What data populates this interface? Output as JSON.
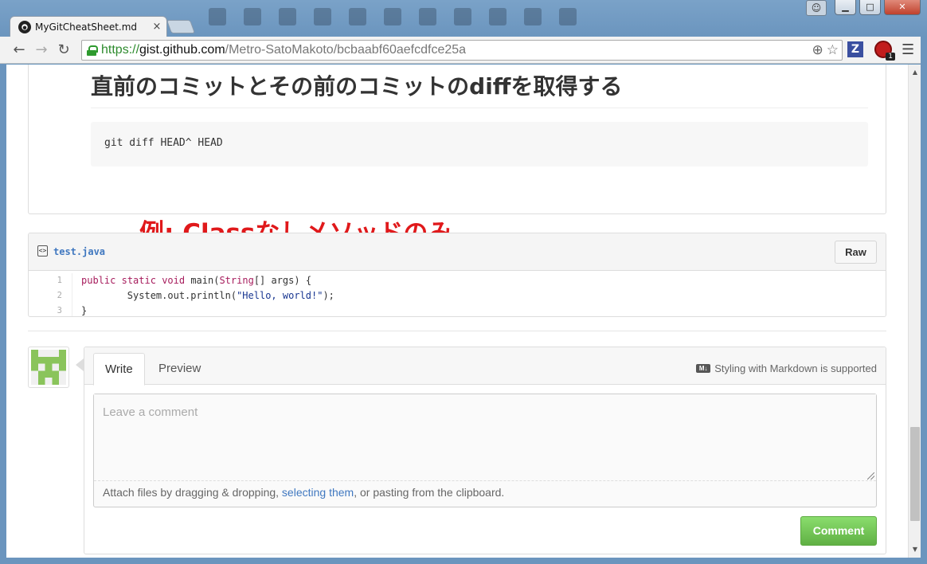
{
  "browser": {
    "tab_title": "MyGitCheatSheet.md",
    "tab_close": "×",
    "url_scheme": "https://",
    "url_host": "gist.github.com",
    "url_path": "/Metro-SatoMakoto/bcbaabf60aefcdfce25a",
    "ext_badge_count": "1",
    "ext_z_label": "Z"
  },
  "markdown": {
    "heading": "直前のコミットとその前のコミットのdiffを取得する",
    "code": "git diff HEAD^ HEAD"
  },
  "annotation": "例: Classなしメソッドのみ。",
  "file": {
    "icon_label": "<>",
    "name": "test.java",
    "raw_label": "Raw",
    "lines": [
      {
        "num": "1"
      },
      {
        "num": "2"
      },
      {
        "num": "3"
      }
    ]
  },
  "comment": {
    "tab_write": "Write",
    "tab_preview": "Preview",
    "markdown_icon": "M↓",
    "markdown_hint": "Styling with Markdown is supported",
    "placeholder": "Leave a comment",
    "attach_prefix": "Attach files by dragging & dropping, ",
    "attach_link": "selecting them",
    "attach_suffix": ", or pasting from the clipboard.",
    "submit_label": "Comment"
  }
}
